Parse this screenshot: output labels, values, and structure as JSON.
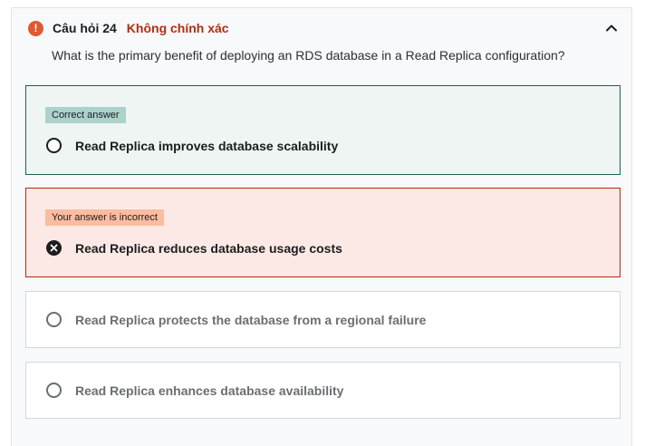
{
  "question": {
    "number_label": "Câu hỏi 24",
    "status_label": "Không chính xác",
    "text": "What is the primary benefit of deploying an RDS database in a Read Replica configuration?"
  },
  "icons": {
    "status": "warning-icon",
    "collapse": "chevron-up-icon"
  },
  "colors": {
    "status_red": "#b32d0f",
    "correct_border": "#1e6055",
    "correct_bg": "#eef5f2",
    "correct_badge": "#acd2cc",
    "incorrect_bg": "#fce9e6",
    "incorrect_badge": "#fcbca0"
  },
  "options": [
    {
      "badge": "Correct answer",
      "label": "Read Replica improves database scalability",
      "state": "correct"
    },
    {
      "badge": "Your answer is incorrect",
      "label": "Read Replica reduces database usage costs",
      "state": "selected-incorrect"
    },
    {
      "label": "Read Replica protects the database from a regional failure",
      "state": "unselected"
    },
    {
      "label": "Read Replica enhances database availability",
      "state": "unselected"
    }
  ]
}
